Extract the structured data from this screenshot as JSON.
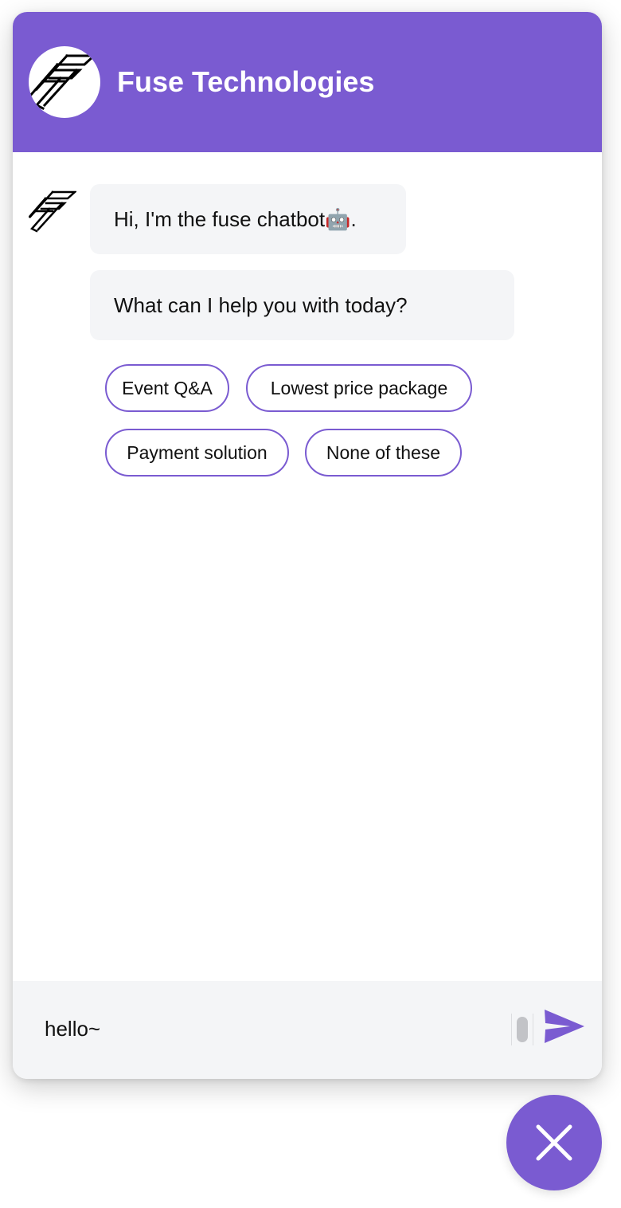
{
  "brand": {
    "accent_color": "#7a5bd1",
    "logo_icon": "fuse-f-logo"
  },
  "header": {
    "title": "Fuse Technologies"
  },
  "messages": [
    {
      "sender": "bot",
      "text": "Hi, I'm the fuse chatbot🤖."
    },
    {
      "sender": "bot",
      "text": "What can I help you with today?"
    }
  ],
  "quick_replies": [
    "Event Q&A",
    "Lowest price package",
    "Payment solution",
    "None of these"
  ],
  "composer": {
    "value": "hello~",
    "send_icon": "send-icon"
  },
  "launcher": {
    "icon": "close-icon"
  }
}
